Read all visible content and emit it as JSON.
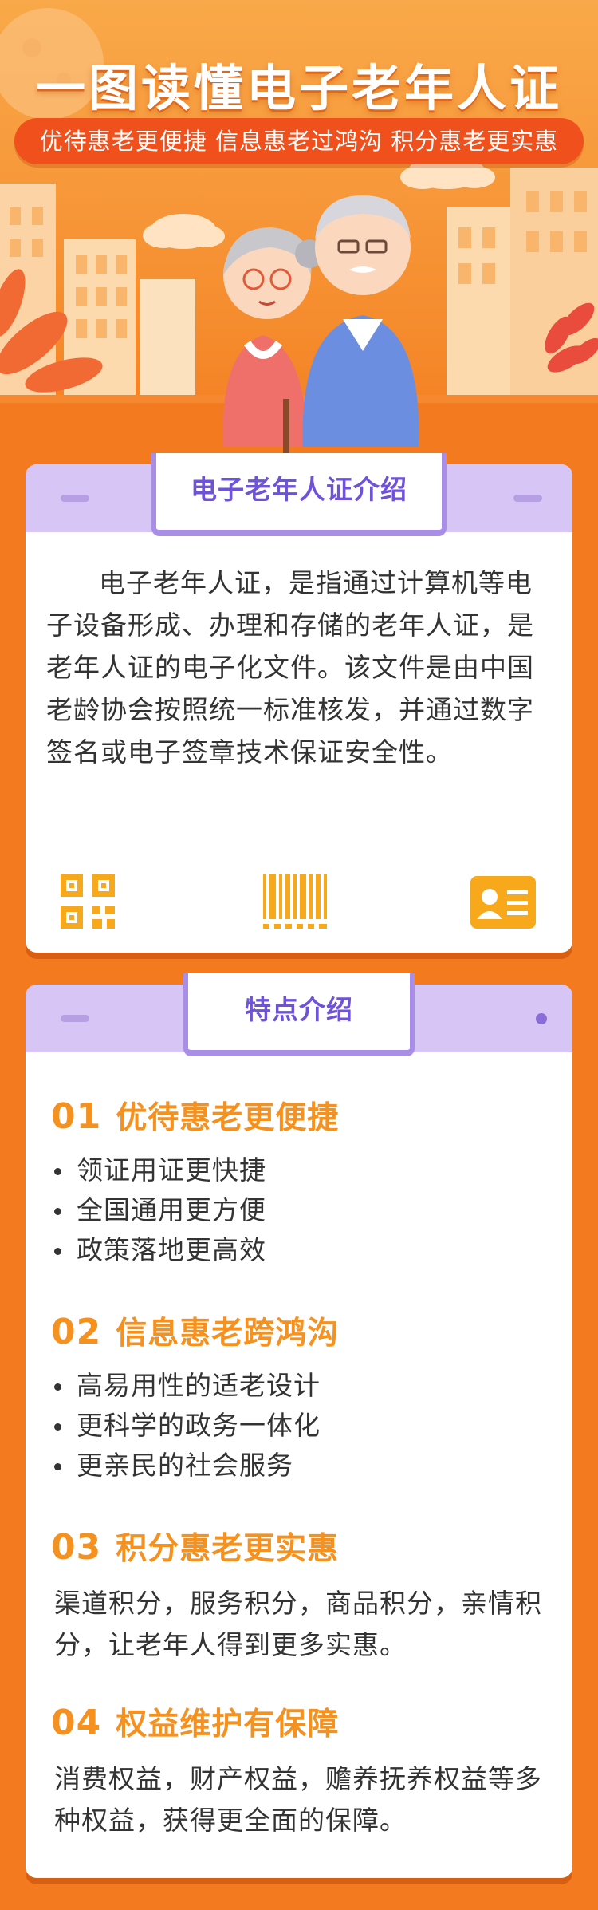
{
  "header": {
    "title": "一图读懂电子老年人证",
    "subtitle": "优待惠老更便捷 信息惠老过鸿沟 积分惠老更实惠"
  },
  "intro": {
    "heading": "电子老年人证介绍",
    "text": "电子老年人证，是指通过计算机等电子设备形成、办理和存储的老年人证，是老年人证的电子化文件。该文件是由中国老龄协会按照统一标准核发，并通过数字签名或电子签章技术保证安全性。",
    "icons": [
      "qr-code-icon",
      "barcode-icon",
      "id-card-icon"
    ]
  },
  "features": {
    "heading": "特点介绍",
    "items": [
      {
        "num": "01",
        "title": "优待惠老更便捷",
        "bullets": [
          "领证用证更快捷",
          "全国通用更方便",
          "政策落地更高效"
        ]
      },
      {
        "num": "02",
        "title": "信息惠老跨鸿沟",
        "bullets": [
          "高易用性的适老设计",
          "更科学的政务一体化",
          "更亲民的社会服务"
        ]
      },
      {
        "num": "03",
        "title": "积分惠老更实惠",
        "text": "渠道积分，服务积分，商品积分，亲情积分，让老年人得到更多实惠。"
      },
      {
        "num": "04",
        "title": "权益维护有保障",
        "text": "消费权益，财产权益，赡养抚养权益等多种权益，获得更全面的保障。"
      }
    ]
  },
  "colors": {
    "orange": "#f47a1f",
    "accent_orange": "#f5911f",
    "banner_red": "#f0501c",
    "purple": "#6e53d6",
    "lavender": "#d7c5f5"
  }
}
